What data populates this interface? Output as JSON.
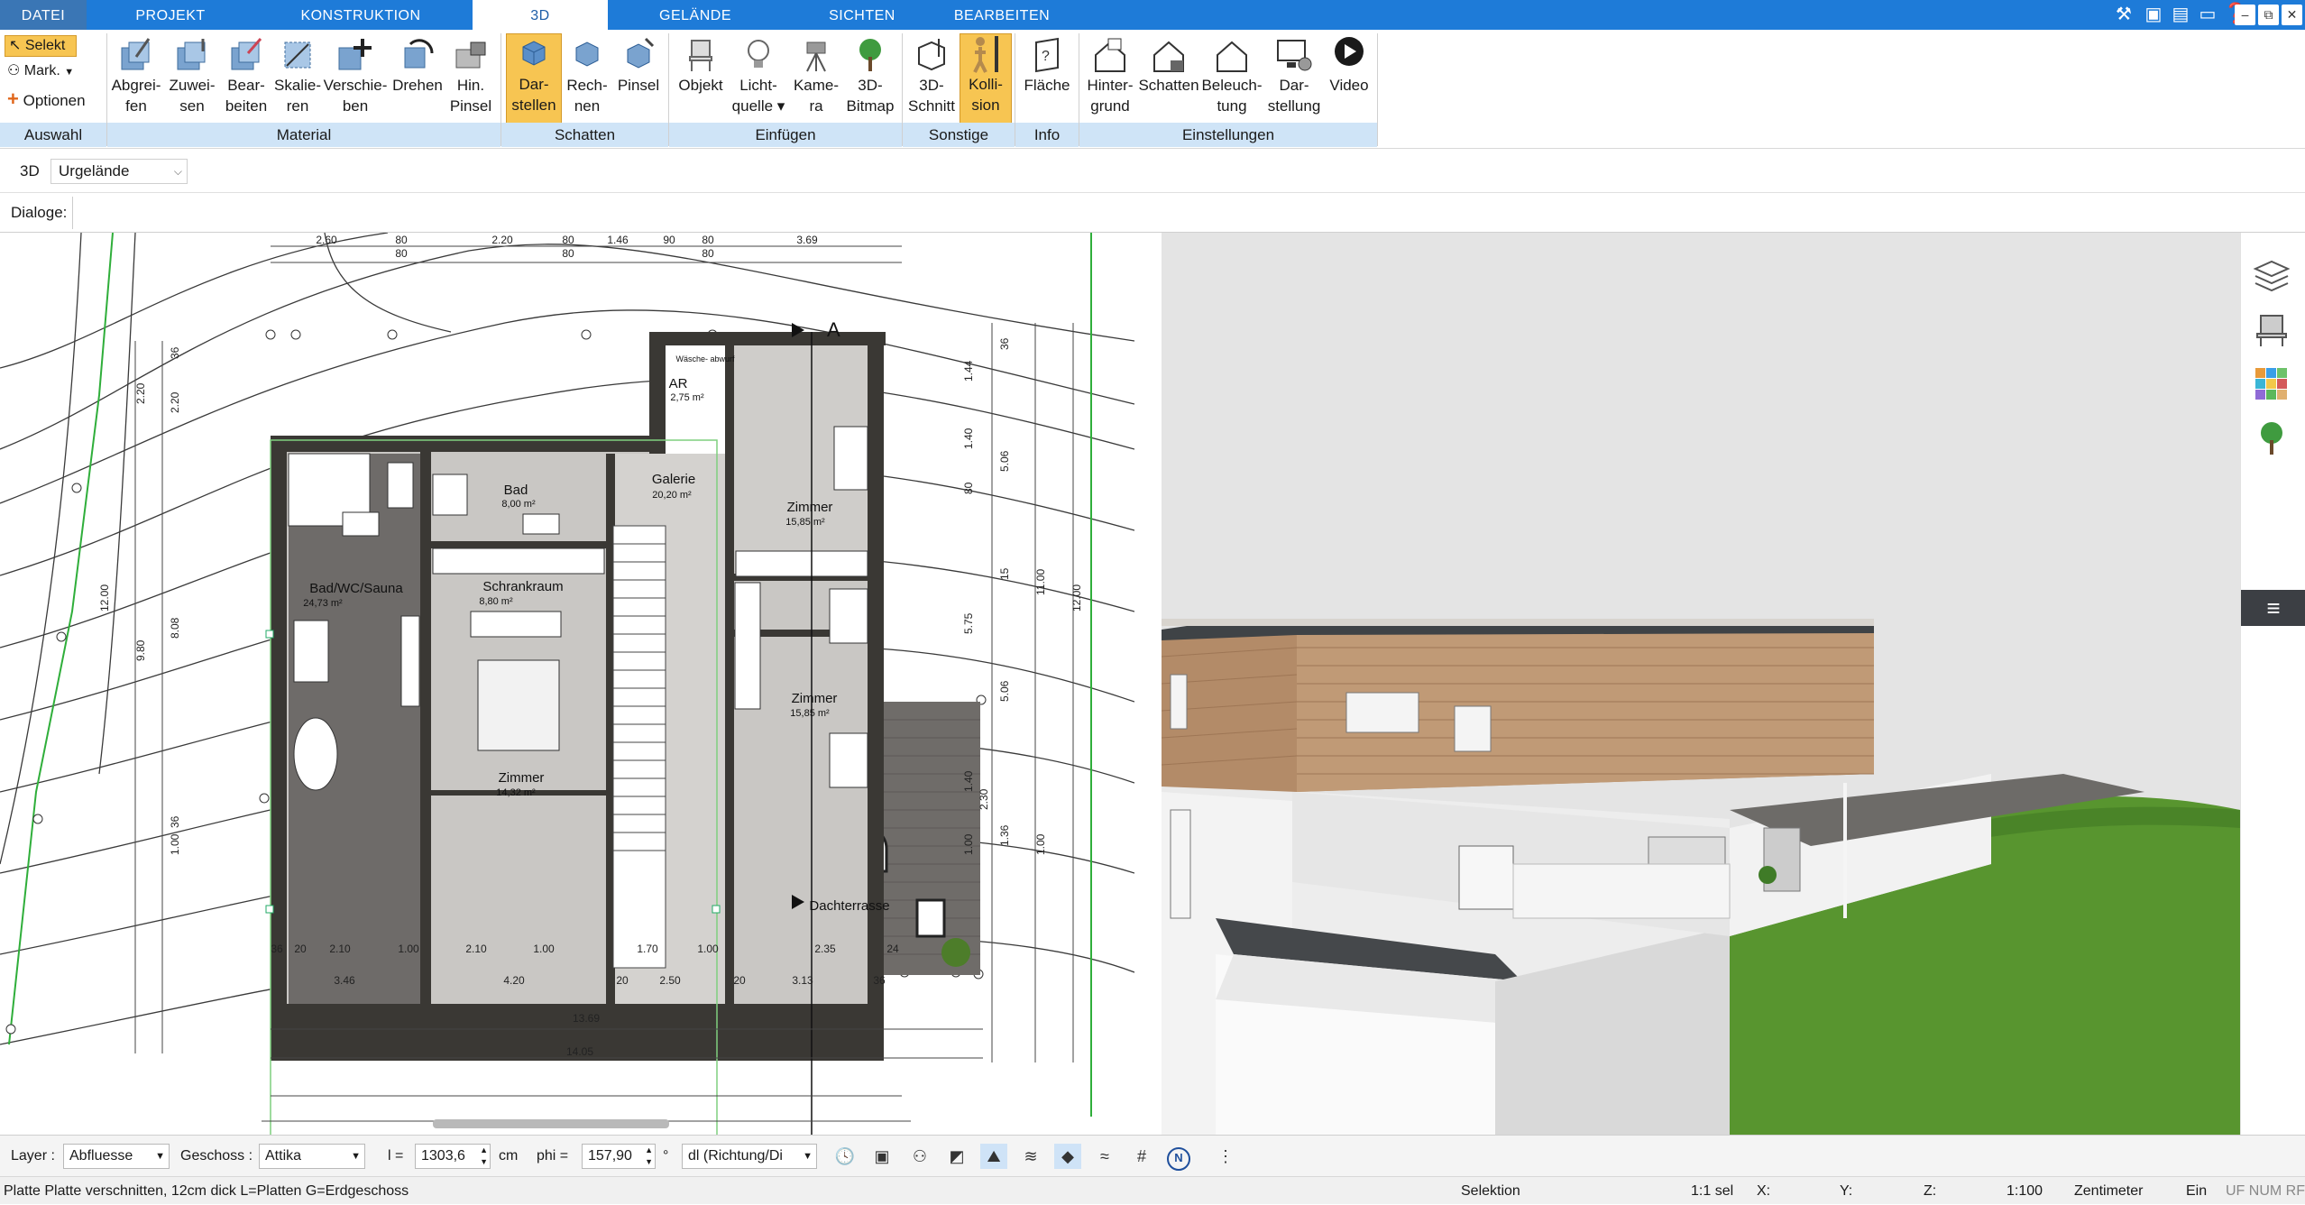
{
  "tabs": [
    {
      "label": "DATEI",
      "key": "file"
    },
    {
      "label": "PROJEKT",
      "key": "projekt"
    },
    {
      "label": "KONSTRUKTION",
      "key": "konstruktion"
    },
    {
      "label": "3D",
      "key": "3d"
    },
    {
      "label": "GELÄNDE",
      "key": "gelaende"
    },
    {
      "label": "SICHTEN",
      "key": "sichten"
    },
    {
      "label": "BEARBEITEN",
      "key": "bearbeiten"
    }
  ],
  "ribbon": {
    "auswahl": {
      "select": "Selekt",
      "mark": "Mark.",
      "options": "Optionen",
      "group": "Auswahl"
    },
    "material": {
      "group": "Material",
      "buttons": [
        {
          "l1": "Abgrei-",
          "l2": "fen"
        },
        {
          "l1": "Zuwei-",
          "l2": "sen"
        },
        {
          "l1": "Bear-",
          "l2": "beiten"
        },
        {
          "l1": "Skalie-",
          "l2": "ren"
        },
        {
          "l1": "Verschie-",
          "l2": "ben"
        },
        {
          "l1": "Drehen",
          "l2": ""
        },
        {
          "l1": "Hin.",
          "l2": "Pinsel"
        }
      ]
    },
    "schatten": {
      "group": "Schatten",
      "buttons": [
        {
          "l1": "Dar-",
          "l2": "stellen"
        },
        {
          "l1": "Rech-",
          "l2": "nen"
        },
        {
          "l1": "Pinsel",
          "l2": ""
        }
      ]
    },
    "einfuegen": {
      "group": "Einfügen",
      "buttons": [
        {
          "l1": "Objekt",
          "l2": ""
        },
        {
          "l1": "Licht-",
          "l2": "quelle ▾"
        },
        {
          "l1": "Kame-",
          "l2": "ra"
        },
        {
          "l1": "3D-",
          "l2": "Bitmap"
        }
      ]
    },
    "sonstige": {
      "group": "Sonstige",
      "buttons": [
        {
          "l1": "3D-",
          "l2": "Schnitt"
        },
        {
          "l1": "Kolli-",
          "l2": "sion"
        }
      ]
    },
    "info": {
      "group": "Info",
      "buttons": [
        {
          "l1": "Fläche",
          "l2": ""
        }
      ]
    },
    "einstellungen": {
      "group": "Einstellungen",
      "buttons": [
        {
          "l1": "Hinter-",
          "l2": "grund"
        },
        {
          "l1": "Schatten",
          "l2": ""
        },
        {
          "l1": "Beleuch-",
          "l2": "tung"
        },
        {
          "l1": "Dar-",
          "l2": "stellung"
        },
        {
          "l1": "Video",
          "l2": ""
        }
      ]
    }
  },
  "subtoolbar": {
    "mode": "3D",
    "terrain": "Urgelände",
    "dialoge": "Dialoge:"
  },
  "plan": {
    "rooms": [
      {
        "name": "Bad",
        "area": "8,00 m²"
      },
      {
        "name": "Galerie",
        "area": "20,20 m²"
      },
      {
        "name": "AR",
        "area": "2,75 m²"
      },
      {
        "name": "Zimmer",
        "area": "15,85 m²"
      },
      {
        "name": "Bad/WC/Sauna",
        "area": "24,73 m²"
      },
      {
        "name": "Schrankraum",
        "area": "8,80 m²"
      },
      {
        "name": "Zimmer",
        "area": "15,85 m²"
      },
      {
        "name": "Zimmer",
        "area": "14,32 m²"
      },
      {
        "name": "Dachterrasse",
        "area": ""
      }
    ],
    "small_label": "Wäsche-\nabwurf",
    "section_mark": "A",
    "top_dims": [
      "2.60",
      "80",
      "80",
      "2.20",
      "80",
      "80",
      "1.46",
      "90",
      "80",
      "80",
      "3.69"
    ],
    "bottom_dims_1": [
      "36",
      "20",
      "2.10",
      "1.00",
      "2.10",
      "1.00",
      "1.70",
      "1.00",
      "2.35",
      "24"
    ],
    "bottom_dims_2": [
      "3.46",
      "4.20",
      "20",
      "2.50",
      "20",
      "3.13",
      "36"
    ],
    "bottom_dims_3": [
      "13.69"
    ],
    "bottom_dims_4": [
      "14.05"
    ],
    "left_dims": [
      "36",
      "2.20",
      "2.20",
      "12.00",
      "9.80",
      "8.08",
      "36",
      "1.00"
    ],
    "right_dims": [
      "1.44",
      "36",
      "1.40",
      "80",
      "5.06",
      "15",
      "11.00",
      "12.00",
      "5.75",
      "5.06",
      "1.40",
      "2.30",
      "1.00",
      "1.36",
      "1.00"
    ]
  },
  "bottombar": {
    "layer_label": "Layer :",
    "layer_value": "Abfluesse",
    "geschoss_label": "Geschoss :",
    "geschoss_value": "Attika",
    "l_label": "l =",
    "l_value": "1303,6",
    "l_unit": "cm",
    "phi_label": "phi =",
    "phi_value": "157,90",
    "phi_unit": "°",
    "dl_value": "dl (Richtung/Di"
  },
  "status": {
    "message": "Platte Platte verschnitten, 12cm dick L=Platten G=Erdgeschoss",
    "selektion": "Selektion",
    "sel": "1:1 sel",
    "x": "X:",
    "y": "Y:",
    "z": "Z:",
    "scale": "1:100",
    "unit": "Zentimeter",
    "ein": "Ein",
    "flags": "UF NUM RF"
  },
  "colors": {
    "tab_blue": "#1e7bd8",
    "group_bar": "#cfe4f7",
    "active_button": "#f7c552",
    "grass": "#4f8e32",
    "wood": "#b98e6a",
    "wall": "#3c3a36",
    "floor": "#c8c6c3"
  }
}
